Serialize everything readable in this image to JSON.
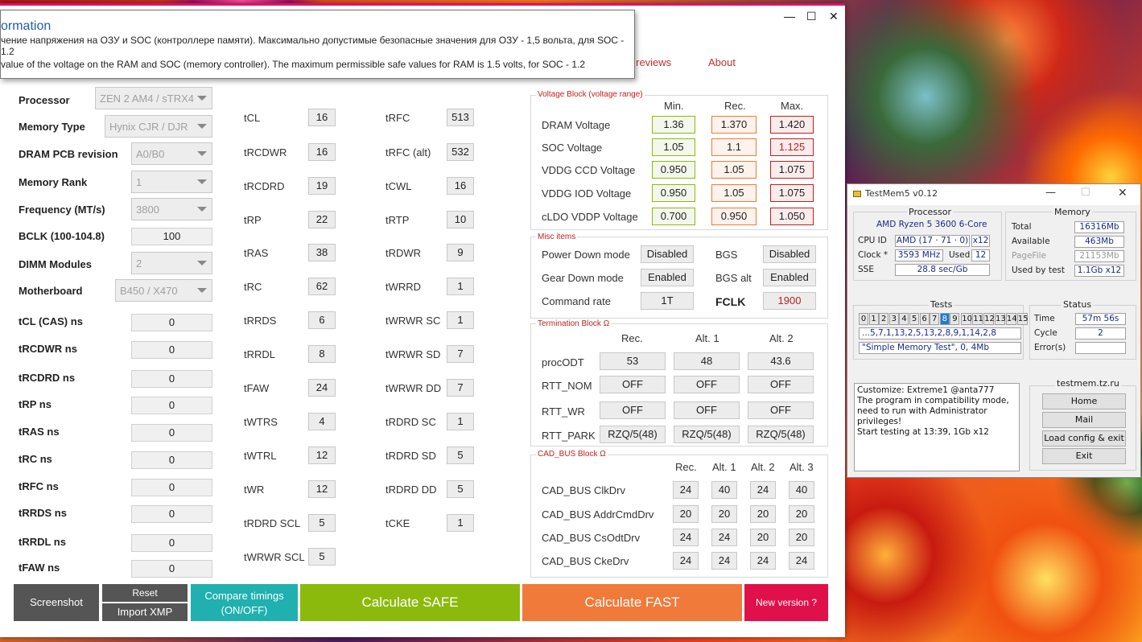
{
  "tooltip": {
    "title": "ormation",
    "line_ru": "чение напряжения на ОЗУ и SOC (контроллере памяти). Максимально допустимые безопасные значения для ОЗУ - 1,5 вольта, для SOC - 1.2",
    "line_en": "value of the voltage on the RAM and SOC (memory controller). The maximum permissible safe values for RAM is 1.5 volts, for SOC - 1.2"
  },
  "window": {
    "minimize": "—",
    "maximize": "☐",
    "close": "✕"
  },
  "nav": {
    "reviews": "y reviews",
    "about": "About"
  },
  "left": {
    "processor": {
      "label": "Processor",
      "value": "ZEN 2 AM4 / sTRX4"
    },
    "memory_type": {
      "label": "Memory Type",
      "value": "Hynix CJR / DJR"
    },
    "pcb": {
      "label": "DRAM PCB revision",
      "value": "A0/B0"
    },
    "rank": {
      "label": "Memory Rank",
      "value": "1"
    },
    "freq": {
      "label": "Frequency (MT/s)",
      "value": "3800"
    },
    "bclk": {
      "label": "BCLK (100-104.8)",
      "value": "100"
    },
    "dimm": {
      "label": "DIMM Modules",
      "value": "2"
    },
    "mobo": {
      "label": "Motherboard",
      "value": "B450 / X470"
    },
    "ns": [
      {
        "label": "tCL (CAS) ns",
        "value": "0"
      },
      {
        "label": "tRCDWR ns",
        "value": "0"
      },
      {
        "label": "tRCDRD ns",
        "value": "0"
      },
      {
        "label": "tRP ns",
        "value": "0"
      },
      {
        "label": "tRAS ns",
        "value": "0"
      },
      {
        "label": "tRC ns",
        "value": "0"
      },
      {
        "label": "tRFC ns",
        "value": "0"
      },
      {
        "label": "tRRDS ns",
        "value": "0"
      },
      {
        "label": "tRRDL ns",
        "value": "0"
      },
      {
        "label": "tFAW ns",
        "value": "0"
      }
    ]
  },
  "timings1": [
    {
      "l": "tCL",
      "v": "16"
    },
    {
      "l": "tRCDWR",
      "v": "16"
    },
    {
      "l": "tRCDRD",
      "v": "19"
    },
    {
      "l": "tRP",
      "v": "22"
    },
    {
      "l": "tRAS",
      "v": "38"
    },
    {
      "l": "tRC",
      "v": "62"
    },
    {
      "l": "tRRDS",
      "v": "6"
    },
    {
      "l": "tRRDL",
      "v": "8"
    },
    {
      "l": "tFAW",
      "v": "24"
    },
    {
      "l": "tWTRS",
      "v": "4"
    },
    {
      "l": "tWTRL",
      "v": "12"
    },
    {
      "l": "tWR",
      "v": "12"
    },
    {
      "l": "tRDRD SCL",
      "v": "5"
    },
    {
      "l": "tWRWR SCL",
      "v": "5"
    }
  ],
  "timings2": [
    {
      "l": "tRFC",
      "v": "513"
    },
    {
      "l": "tRFC (alt)",
      "v": "532"
    },
    {
      "l": "tCWL",
      "v": "16"
    },
    {
      "l": "tRTP",
      "v": "10"
    },
    {
      "l": "tRDWR",
      "v": "9"
    },
    {
      "l": "tWRRD",
      "v": "1"
    },
    {
      "l": "tWRWR SC",
      "v": "1"
    },
    {
      "l": "tWRWR SD",
      "v": "7"
    },
    {
      "l": "tWRWR DD",
      "v": "7"
    },
    {
      "l": "tRDRD SC",
      "v": "1"
    },
    {
      "l": "tRDRD SD",
      "v": "5"
    },
    {
      "l": "tRDRD DD",
      "v": "5"
    },
    {
      "l": "tCKE",
      "v": "1"
    }
  ],
  "voltage": {
    "title": "Voltage Block (voltage range)",
    "min": "Min.",
    "rec": "Rec.",
    "max": "Max.",
    "rows": [
      {
        "l": "DRAM Voltage",
        "a": "1.36",
        "b": "1.370",
        "c": "1.420"
      },
      {
        "l": "SOC Voltage",
        "a": "1.05",
        "b": "1.1",
        "c": "1.125"
      },
      {
        "l": "VDDG  CCD Voltage",
        "a": "0.950",
        "b": "1.05",
        "c": "1.075"
      },
      {
        "l": "VDDG  IOD Voltage",
        "a": "0.950",
        "b": "1.05",
        "c": "1.075"
      },
      {
        "l": "cLDO VDDP Voltage",
        "a": "0.700",
        "b": "0.950",
        "c": "1.050"
      }
    ]
  },
  "misc": {
    "title": "Misc items",
    "pdm_l": "Power Down mode",
    "pdm_v": "Disabled",
    "bgs_l": "BGS",
    "bgs_v": "Disabled",
    "gdm_l": "Gear Down mode",
    "gdm_v": "Enabled",
    "bgsalt_l": "BGS alt",
    "bgsalt_v": "Enabled",
    "cr_l": "Command rate",
    "cr_v": "1T",
    "fclk_l": "FCLK",
    "fclk_v": "1900"
  },
  "term": {
    "title": "Termination Block Ω",
    "h1": "Rec.",
    "h2": "Alt. 1",
    "h3": "Alt. 2",
    "rows": [
      {
        "l": "procODT",
        "a": "53",
        "b": "48",
        "c": "43.6"
      },
      {
        "l": "RTT_NOM",
        "a": "OFF",
        "b": "OFF",
        "c": "OFF"
      },
      {
        "l": "RTT_WR",
        "a": "OFF",
        "b": "OFF",
        "c": "OFF"
      },
      {
        "l": "RTT_PARK",
        "a": "RZQ/5(48)",
        "b": "RZQ/5(48)",
        "c": "RZQ/5(48)"
      }
    ]
  },
  "cad": {
    "title": "CAD_BUS Block Ω",
    "h1": "Rec.",
    "h2": "Alt. 1",
    "h3": "Alt. 2",
    "h4": "Alt. 3",
    "rows": [
      {
        "l": "CAD_BUS ClkDrv",
        "a": "24",
        "b": "40",
        "c": "24",
        "d": "40"
      },
      {
        "l": "CAD_BUS AddrCmdDrv",
        "a": "20",
        "b": "20",
        "c": "20",
        "d": "20"
      },
      {
        "l": "CAD_BUS CsOdtDrv",
        "a": "24",
        "b": "24",
        "c": "20",
        "d": "20"
      },
      {
        "l": "CAD_BUS CkeDrv",
        "a": "24",
        "b": "24",
        "c": "24",
        "d": "24"
      }
    ]
  },
  "buttons": {
    "screenshot": "Screenshot",
    "reset": "Reset",
    "import": "Import XMP",
    "compare": "Compare timings (ON/OFF)",
    "safe": "Calculate SAFE",
    "fast": "Calculate FAST",
    "newver": "New version ?"
  },
  "colors": {
    "accent": "#e0106a",
    "teal": "#20b0b0",
    "green": "#8cba0c",
    "orange": "#f07a3a",
    "crimson": "#e0104a",
    "gray": "#555555"
  },
  "testmem": {
    "title": "TestMem5 v0.12",
    "proc_cap": "Processor",
    "proc": "AMD Ryzen 5 3600 6-Core",
    "cpuid_l": "CPU ID",
    "cpuid": "AMD  (17 · 71 · 0)",
    "x12": "x12",
    "clock_l": "Clock *",
    "clock": "3593 MHz",
    "used_l": "Used",
    "used": "12",
    "sse_l": "SSE",
    "sse": "28.8 sec/Gb",
    "mem_cap": "Memory",
    "total_l": "Total",
    "total": "16316Mb",
    "avail_l": "Available",
    "avail": "463Mb",
    "pf_l": "PageFile",
    "pf": "21153Mb",
    "ubt_l": "Used by test",
    "ubt": "1.1Gb x12",
    "tests_cap": "Tests",
    "tests": [
      "0",
      "1",
      "2",
      "3",
      "4",
      "5",
      "6",
      "7",
      "8",
      "9",
      "10",
      "11",
      "12",
      "13",
      "14",
      "15"
    ],
    "seq": "...5,7,1,13,2,5,13,2,8,9,1,14,2,8",
    "cur": "\"Simple Memory Test\", 0, 4Mb",
    "status_cap": "Status",
    "time_l": "Time",
    "time": "57m 56s",
    "cycle_l": "Cycle",
    "cycle": "2",
    "err_l": "Error(s)",
    "err": "",
    "log": "Customize: Extreme1 @anta777\nThe program in compatibility mode,\nneed to run with Administrator privileges!\nStart testing at 13:39, 1Gb x12",
    "site_cap": "testmem.tz.ru",
    "home": "Home",
    "mail": "Mail",
    "load": "Load config & exit",
    "exit": "Exit"
  }
}
